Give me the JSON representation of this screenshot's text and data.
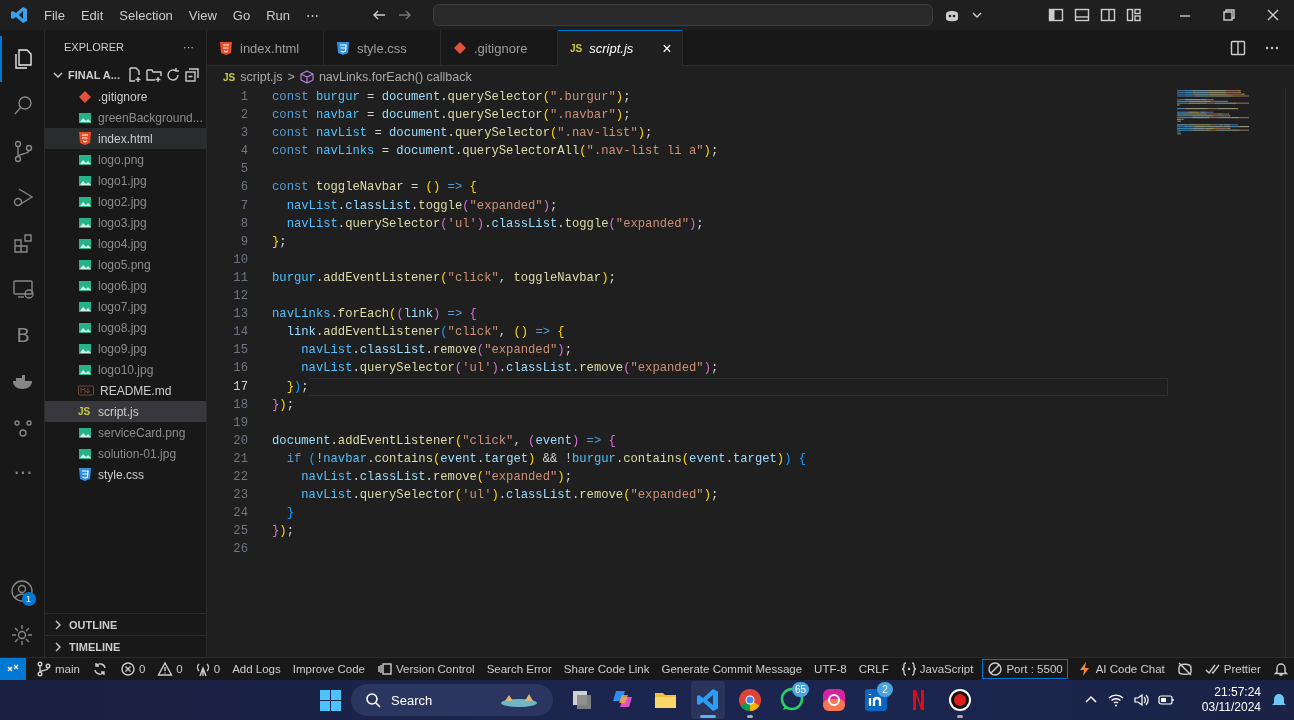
{
  "title_bar": {
    "menu": [
      "File",
      "Edit",
      "Selection",
      "View",
      "Go",
      "Run",
      "⋯"
    ]
  },
  "activity_bar": {
    "items": [
      {
        "kind": "files",
        "selected": true
      },
      {
        "kind": "search",
        "selected": false
      },
      {
        "kind": "branch",
        "selected": false
      },
      {
        "kind": "debug",
        "selected": false
      },
      {
        "kind": "extensions",
        "selected": false
      },
      {
        "kind": "remote",
        "selected": false
      },
      {
        "kind": "letter",
        "label": "B",
        "selected": false
      },
      {
        "kind": "docker",
        "selected": false
      },
      {
        "kind": "face",
        "selected": false
      },
      {
        "kind": "more",
        "label": "···",
        "selected": false
      }
    ],
    "account_badge": "1"
  },
  "sidebar": {
    "title": "EXPLORER",
    "more": "···",
    "folder": {
      "name": "FINAL A...",
      "expanded": true
    },
    "files": [
      {
        "name": ".gitignore",
        "kind": "git",
        "dimmed": false,
        "selected": false,
        "hovered": false
      },
      {
        "name": "greenBackground...",
        "kind": "image",
        "dimmed": true,
        "selected": false,
        "hovered": false
      },
      {
        "name": "index.html",
        "kind": "html",
        "dimmed": false,
        "selected": false,
        "hovered": true
      },
      {
        "name": "logo.png",
        "kind": "image",
        "dimmed": true,
        "selected": false,
        "hovered": false
      },
      {
        "name": "logo1.jpg",
        "kind": "image",
        "dimmed": true,
        "selected": false,
        "hovered": false
      },
      {
        "name": "logo2.jpg",
        "kind": "image",
        "dimmed": true,
        "selected": false,
        "hovered": false
      },
      {
        "name": "logo3.jpg",
        "kind": "image",
        "dimmed": true,
        "selected": false,
        "hovered": false
      },
      {
        "name": "logo4.jpg",
        "kind": "image",
        "dimmed": true,
        "selected": false,
        "hovered": false
      },
      {
        "name": "logo5.png",
        "kind": "image",
        "dimmed": true,
        "selected": false,
        "hovered": false
      },
      {
        "name": "logo6.jpg",
        "kind": "image",
        "dimmed": true,
        "selected": false,
        "hovered": false
      },
      {
        "name": "logo7.jpg",
        "kind": "image",
        "dimmed": true,
        "selected": false,
        "hovered": false
      },
      {
        "name": "logo8.jpg",
        "kind": "image",
        "dimmed": true,
        "selected": false,
        "hovered": false
      },
      {
        "name": "logo9.jpg",
        "kind": "image",
        "dimmed": true,
        "selected": false,
        "hovered": false
      },
      {
        "name": "logo10.jpg",
        "kind": "image",
        "dimmed": true,
        "selected": false,
        "hovered": false
      },
      {
        "name": "README.md",
        "kind": "markdown",
        "dimmed": false,
        "selected": false,
        "hovered": false
      },
      {
        "name": "script.js",
        "kind": "js",
        "icon_text": "JS",
        "dimmed": false,
        "selected": true,
        "hovered": false
      },
      {
        "name": "serviceCard.png",
        "kind": "image",
        "dimmed": true,
        "selected": false,
        "hovered": false
      },
      {
        "name": "solution-01.jpg",
        "kind": "image",
        "dimmed": true,
        "selected": false,
        "hovered": false
      },
      {
        "name": "style.css",
        "kind": "css",
        "dimmed": false,
        "selected": false,
        "hovered": false
      }
    ],
    "sections": [
      {
        "title": "OUTLINE",
        "expanded": false
      },
      {
        "title": "TIMELINE",
        "expanded": false
      }
    ]
  },
  "editor": {
    "tabs": [
      {
        "label": "index.html",
        "kind": "html",
        "selected": false
      },
      {
        "label": "style.css",
        "kind": "css",
        "selected": false
      },
      {
        "label": ".gitignore",
        "kind": "git",
        "selected": false
      },
      {
        "label": "script.js",
        "kind": "js",
        "icon_text": "JS",
        "selected": true,
        "close": "×"
      }
    ],
    "breadcrumb": {
      "icon_text": "JS",
      "file": "script.js",
      "separator": ">",
      "symbol": "navLinks.forEach() callback"
    },
    "lines": [
      {
        "number": "1",
        "current": false,
        "tokens": [
          {
            "kind": "keyword",
            "text": "const "
          },
          {
            "kind": "constant",
            "text": "burgur"
          },
          {
            "kind": "plain",
            "text": " = "
          },
          {
            "kind": "variable",
            "text": "document"
          },
          {
            "kind": "plain",
            "text": "."
          },
          {
            "kind": "function",
            "text": "querySelector"
          },
          {
            "kind": "bracket",
            "text": "("
          },
          {
            "kind": "string",
            "text": "\".burgur\""
          },
          {
            "kind": "bracket",
            "text": ")"
          },
          {
            "kind": "plain",
            "text": ";"
          }
        ]
      },
      {
        "number": "2",
        "current": false,
        "tokens": [
          {
            "kind": "keyword",
            "text": "const "
          },
          {
            "kind": "constant",
            "text": "navbar"
          },
          {
            "kind": "plain",
            "text": " = "
          },
          {
            "kind": "variable",
            "text": "document"
          },
          {
            "kind": "plain",
            "text": "."
          },
          {
            "kind": "function",
            "text": "querySelector"
          },
          {
            "kind": "bracket",
            "text": "("
          },
          {
            "kind": "string",
            "text": "\".navbar\""
          },
          {
            "kind": "bracket",
            "text": ")"
          },
          {
            "kind": "plain",
            "text": ";"
          }
        ]
      },
      {
        "number": "3",
        "current": false,
        "tokens": [
          {
            "kind": "keyword",
            "text": "const "
          },
          {
            "kind": "constant",
            "text": "navList"
          },
          {
            "kind": "plain",
            "text": " = "
          },
          {
            "kind": "variable",
            "text": "document"
          },
          {
            "kind": "plain",
            "text": "."
          },
          {
            "kind": "function",
            "text": "querySelector"
          },
          {
            "kind": "bracket",
            "text": "("
          },
          {
            "kind": "string",
            "text": "\".nav-list\""
          },
          {
            "kind": "bracket",
            "text": ")"
          },
          {
            "kind": "plain",
            "text": ";"
          }
        ]
      },
      {
        "number": "4",
        "current": false,
        "tokens": [
          {
            "kind": "keyword",
            "text": "const "
          },
          {
            "kind": "constant",
            "text": "navLinks"
          },
          {
            "kind": "plain",
            "text": " = "
          },
          {
            "kind": "variable",
            "text": "document"
          },
          {
            "kind": "plain",
            "text": "."
          },
          {
            "kind": "function",
            "text": "querySelectorAll"
          },
          {
            "kind": "bracket",
            "text": "("
          },
          {
            "kind": "string",
            "text": "\".nav-list li a\""
          },
          {
            "kind": "bracket",
            "text": ")"
          },
          {
            "kind": "plain",
            "text": ";"
          }
        ]
      },
      {
        "number": "5",
        "current": false
      },
      {
        "number": "6",
        "current": false,
        "tokens": [
          {
            "kind": "keyword",
            "text": "const "
          },
          {
            "kind": "function",
            "text": "toggleNavbar"
          },
          {
            "kind": "plain",
            "text": " = "
          },
          {
            "kind": "bracket",
            "text": "()"
          },
          {
            "kind": "keyword",
            "text": " => "
          },
          {
            "kind": "bracket",
            "text": "{"
          }
        ]
      },
      {
        "number": "7",
        "current": false,
        "tokens": [
          {
            "kind": "constant",
            "text": "  navList"
          },
          {
            "kind": "plain",
            "text": "."
          },
          {
            "kind": "variable",
            "text": "classList"
          },
          {
            "kind": "plain",
            "text": "."
          },
          {
            "kind": "function",
            "text": "toggle"
          },
          {
            "kind": "bracket2",
            "text": "("
          },
          {
            "kind": "string",
            "text": "\"expanded\""
          },
          {
            "kind": "bracket2",
            "text": ")"
          },
          {
            "kind": "plain",
            "text": ";"
          }
        ]
      },
      {
        "number": "8",
        "current": false,
        "tokens": [
          {
            "kind": "constant",
            "text": "  navList"
          },
          {
            "kind": "plain",
            "text": "."
          },
          {
            "kind": "function",
            "text": "querySelector"
          },
          {
            "kind": "bracket2",
            "text": "("
          },
          {
            "kind": "string",
            "text": "'ul'"
          },
          {
            "kind": "bracket2",
            "text": ")"
          },
          {
            "kind": "plain",
            "text": "."
          },
          {
            "kind": "variable",
            "text": "classList"
          },
          {
            "kind": "plain",
            "text": "."
          },
          {
            "kind": "function",
            "text": "toggle"
          },
          {
            "kind": "bracket2",
            "text": "("
          },
          {
            "kind": "string",
            "text": "\"expanded\""
          },
          {
            "kind": "bracket2",
            "text": ")"
          },
          {
            "kind": "plain",
            "text": ";"
          }
        ]
      },
      {
        "number": "9",
        "current": false,
        "tokens": [
          {
            "kind": "bracket",
            "text": "}"
          },
          {
            "kind": "plain",
            "text": ";"
          }
        ]
      },
      {
        "number": "10",
        "current": false
      },
      {
        "number": "11",
        "current": false,
        "tokens": [
          {
            "kind": "constant",
            "text": "burgur"
          },
          {
            "kind": "plain",
            "text": "."
          },
          {
            "kind": "function",
            "text": "addEventListener"
          },
          {
            "kind": "bracket",
            "text": "("
          },
          {
            "kind": "string",
            "text": "\"click\""
          },
          {
            "kind": "plain",
            "text": ", "
          },
          {
            "kind": "function",
            "text": "toggleNavbar"
          },
          {
            "kind": "bracket",
            "text": ")"
          },
          {
            "kind": "plain",
            "text": ";"
          }
        ]
      },
      {
        "number": "12",
        "current": false
      },
      {
        "number": "13",
        "current": false,
        "tokens": [
          {
            "kind": "constant",
            "text": "navLinks"
          },
          {
            "kind": "plain",
            "text": "."
          },
          {
            "kind": "function",
            "text": "forEach"
          },
          {
            "kind": "bracket",
            "text": "("
          },
          {
            "kind": "bracket2",
            "text": "("
          },
          {
            "kind": "variable",
            "text": "link"
          },
          {
            "kind": "bracket2",
            "text": ")"
          },
          {
            "kind": "keyword",
            "text": " => "
          },
          {
            "kind": "bracket2",
            "text": "{"
          }
        ]
      },
      {
        "number": "14",
        "current": false,
        "tokens": [
          {
            "kind": "variable",
            "text": "  link"
          },
          {
            "kind": "plain",
            "text": "."
          },
          {
            "kind": "function",
            "text": "addEventListener"
          },
          {
            "kind": "bracket3",
            "text": "("
          },
          {
            "kind": "string",
            "text": "\"click\""
          },
          {
            "kind": "plain",
            "text": ", "
          },
          {
            "kind": "bracket",
            "text": "()"
          },
          {
            "kind": "keyword",
            "text": " => "
          },
          {
            "kind": "bracket",
            "text": "{"
          }
        ]
      },
      {
        "number": "15",
        "current": false,
        "tokens": [
          {
            "kind": "constant",
            "text": "    navList"
          },
          {
            "kind": "plain",
            "text": "."
          },
          {
            "kind": "variable",
            "text": "classList"
          },
          {
            "kind": "plain",
            "text": "."
          },
          {
            "kind": "function",
            "text": "remove"
          },
          {
            "kind": "bracket2",
            "text": "("
          },
          {
            "kind": "string",
            "text": "\"expanded\""
          },
          {
            "kind": "bracket2",
            "text": ")"
          },
          {
            "kind": "plain",
            "text": ";"
          }
        ]
      },
      {
        "number": "16",
        "current": false,
        "tokens": [
          {
            "kind": "constant",
            "text": "    navList"
          },
          {
            "kind": "plain",
            "text": "."
          },
          {
            "kind": "function",
            "text": "querySelector"
          },
          {
            "kind": "bracket2",
            "text": "("
          },
          {
            "kind": "string",
            "text": "'ul'"
          },
          {
            "kind": "bracket2",
            "text": ")"
          },
          {
            "kind": "plain",
            "text": "."
          },
          {
            "kind": "variable",
            "text": "classList"
          },
          {
            "kind": "plain",
            "text": "."
          },
          {
            "kind": "function",
            "text": "remove"
          },
          {
            "kind": "bracket2",
            "text": "("
          },
          {
            "kind": "string",
            "text": "\"expanded\""
          },
          {
            "kind": "bracket2",
            "text": ")"
          },
          {
            "kind": "plain",
            "text": ";"
          }
        ]
      },
      {
        "number": "17",
        "current": true,
        "tokens": [
          {
            "kind": "bracket",
            "text": "  }"
          },
          {
            "kind": "bracket3",
            "text": ")"
          },
          {
            "kind": "plain",
            "text": ";"
          }
        ]
      },
      {
        "number": "18",
        "current": false,
        "tokens": [
          {
            "kind": "bracket2",
            "text": "}"
          },
          {
            "kind": "bracket",
            "text": ")"
          },
          {
            "kind": "plain",
            "text": ";"
          }
        ]
      },
      {
        "number": "19",
        "current": false
      },
      {
        "number": "20",
        "current": false,
        "tokens": [
          {
            "kind": "variable",
            "text": "document"
          },
          {
            "kind": "plain",
            "text": "."
          },
          {
            "kind": "function",
            "text": "addEventListener"
          },
          {
            "kind": "bracket",
            "text": "("
          },
          {
            "kind": "string",
            "text": "\"click\""
          },
          {
            "kind": "plain",
            "text": ", "
          },
          {
            "kind": "bracket2",
            "text": "("
          },
          {
            "kind": "variable",
            "text": "event"
          },
          {
            "kind": "bracket2",
            "text": ")"
          },
          {
            "kind": "keyword",
            "text": " => "
          },
          {
            "kind": "bracket2",
            "text": "{"
          }
        ]
      },
      {
        "number": "21",
        "current": false,
        "tokens": [
          {
            "kind": "keyword",
            "text": "  if "
          },
          {
            "kind": "bracket3",
            "text": "("
          },
          {
            "kind": "plain",
            "text": "!"
          },
          {
            "kind": "constant",
            "text": "navbar"
          },
          {
            "kind": "plain",
            "text": "."
          },
          {
            "kind": "function",
            "text": "contains"
          },
          {
            "kind": "bracket",
            "text": "("
          },
          {
            "kind": "variable",
            "text": "event"
          },
          {
            "kind": "plain",
            "text": "."
          },
          {
            "kind": "variable",
            "text": "target"
          },
          {
            "kind": "bracket",
            "text": ")"
          },
          {
            "kind": "plain",
            "text": " && !"
          },
          {
            "kind": "constant",
            "text": "burgur"
          },
          {
            "kind": "plain",
            "text": "."
          },
          {
            "kind": "function",
            "text": "contains"
          },
          {
            "kind": "bracket",
            "text": "("
          },
          {
            "kind": "variable",
            "text": "event"
          },
          {
            "kind": "plain",
            "text": "."
          },
          {
            "kind": "variable",
            "text": "target"
          },
          {
            "kind": "bracket",
            "text": ")"
          },
          {
            "kind": "bracket3",
            "text": ")"
          },
          {
            "kind": "bracket3",
            "text": " {"
          }
        ]
      },
      {
        "number": "22",
        "current": false,
        "tokens": [
          {
            "kind": "constant",
            "text": "    navList"
          },
          {
            "kind": "plain",
            "text": "."
          },
          {
            "kind": "variable",
            "text": "classList"
          },
          {
            "kind": "plain",
            "text": "."
          },
          {
            "kind": "function",
            "text": "remove"
          },
          {
            "kind": "bracket",
            "text": "("
          },
          {
            "kind": "string",
            "text": "\"expanded\""
          },
          {
            "kind": "bracket",
            "text": ")"
          },
          {
            "kind": "plain",
            "text": ";"
          }
        ]
      },
      {
        "number": "23",
        "current": false,
        "tokens": [
          {
            "kind": "constant",
            "text": "    navList"
          },
          {
            "kind": "plain",
            "text": "."
          },
          {
            "kind": "function",
            "text": "querySelector"
          },
          {
            "kind": "bracket",
            "text": "("
          },
          {
            "kind": "string",
            "text": "'ul'"
          },
          {
            "kind": "bracket",
            "text": ")"
          },
          {
            "kind": "plain",
            "text": "."
          },
          {
            "kind": "variable",
            "text": "classList"
          },
          {
            "kind": "plain",
            "text": "."
          },
          {
            "kind": "function",
            "text": "remove"
          },
          {
            "kind": "bracket",
            "text": "("
          },
          {
            "kind": "string",
            "text": "\"expanded\""
          },
          {
            "kind": "bracket",
            "text": ")"
          },
          {
            "kind": "plain",
            "text": ";"
          }
        ]
      },
      {
        "number": "24",
        "current": false,
        "tokens": [
          {
            "kind": "bracket3",
            "text": "  }"
          }
        ]
      },
      {
        "number": "25",
        "current": false,
        "tokens": [
          {
            "kind": "bracket2",
            "text": "}"
          },
          {
            "kind": "bracket",
            "text": ")"
          },
          {
            "kind": "plain",
            "text": ";"
          }
        ]
      },
      {
        "number": "26",
        "current": false
      }
    ]
  },
  "status_bar": {
    "left": [
      {
        "kind": "remote",
        "outlined": false
      },
      {
        "kind": "branch",
        "text": "main",
        "outlined": false
      },
      {
        "kind": "sync",
        "outlined": false
      },
      {
        "kind": "errors",
        "text": "0",
        "outlined": false
      },
      {
        "kind": "warnings",
        "text": "0",
        "outlined": false
      },
      {
        "kind": "ports",
        "text": "0",
        "outlined": false
      },
      {
        "kind": "text",
        "text": "Add Logs",
        "outlined": false
      },
      {
        "kind": "text",
        "text": "Improve Code",
        "outlined": false
      },
      {
        "kind": "panel",
        "text": "Version Control",
        "outlined": false
      },
      {
        "kind": "text",
        "text": "Search Error",
        "outlined": false
      },
      {
        "kind": "text",
        "text": "Share Code Link",
        "outlined": false
      },
      {
        "kind": "text",
        "text": "Generate Commit Message",
        "outlined": false
      }
    ],
    "right": [
      {
        "kind": "text",
        "text": "UTF-8",
        "outlined": false
      },
      {
        "kind": "text",
        "text": "CRLF",
        "outlined": false
      },
      {
        "kind": "language",
        "text": "JavaScript",
        "outlined": false
      },
      {
        "kind": "server",
        "text": "Port : 5500",
        "outlined": true
      },
      {
        "kind": "chat",
        "text": "AI Code Chat",
        "outlined": false
      },
      {
        "kind": "copilot",
        "outlined": false
      },
      {
        "kind": "formatter",
        "text": "Prettier",
        "outlined": false
      },
      {
        "kind": "notifications",
        "outlined": false
      }
    ]
  },
  "taskbar": {
    "search": "Search",
    "apps": [
      {
        "kind": "taskview",
        "running": false,
        "focused": false
      },
      {
        "kind": "copilot",
        "running": false,
        "focused": false
      },
      {
        "kind": "folder",
        "running": false,
        "focused": false
      },
      {
        "kind": "vscode",
        "running": true,
        "focused": true
      },
      {
        "kind": "chrome",
        "running": true,
        "focused": false
      },
      {
        "kind": "whatsapp",
        "badge": "65",
        "running": false,
        "focused": false
      },
      {
        "kind": "instagram",
        "running": false,
        "focused": false
      },
      {
        "kind": "linkedin",
        "badge": "2",
        "running": false,
        "focused": false
      },
      {
        "kind": "netflix",
        "running": false,
        "focused": false
      },
      {
        "kind": "recorder",
        "running": true,
        "focused": false
      }
    ],
    "time": "21:57:24",
    "date": "03/11/2024"
  }
}
